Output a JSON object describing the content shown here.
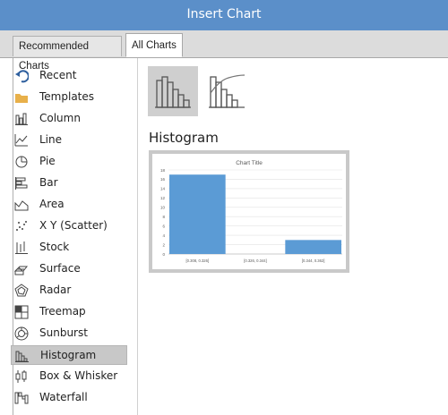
{
  "window": {
    "title": "Insert Chart"
  },
  "tabs": [
    {
      "label": "Recommended Charts",
      "active": false
    },
    {
      "label": "All Charts",
      "active": true
    }
  ],
  "sidebar": {
    "items": [
      {
        "label": "Recent",
        "icon": "undo-arrow-icon"
      },
      {
        "label": "Templates",
        "icon": "folder-icon"
      },
      {
        "label": "Column",
        "icon": "column-chart-icon"
      },
      {
        "label": "Line",
        "icon": "line-chart-icon"
      },
      {
        "label": "Pie",
        "icon": "pie-chart-icon"
      },
      {
        "label": "Bar",
        "icon": "bar-chart-icon"
      },
      {
        "label": "Area",
        "icon": "area-chart-icon"
      },
      {
        "label": "X Y (Scatter)",
        "icon": "scatter-chart-icon"
      },
      {
        "label": "Stock",
        "icon": "stock-chart-icon"
      },
      {
        "label": "Surface",
        "icon": "surface-chart-icon"
      },
      {
        "label": "Radar",
        "icon": "radar-chart-icon"
      },
      {
        "label": "Treemap",
        "icon": "treemap-chart-icon"
      },
      {
        "label": "Sunburst",
        "icon": "sunburst-chart-icon"
      },
      {
        "label": "Histogram",
        "icon": "histogram-chart-icon",
        "selected": true
      },
      {
        "label": "Box & Whisker",
        "icon": "box-whisker-chart-icon"
      },
      {
        "label": "Waterfall",
        "icon": "waterfall-chart-icon"
      }
    ]
  },
  "main": {
    "heading": "Histogram",
    "variants": [
      {
        "name": "histogram",
        "selected": true
      },
      {
        "name": "pareto",
        "selected": false
      }
    ]
  },
  "colors": {
    "titlebar": "#5b8fc9",
    "bar": "#5b9bd5",
    "folder": "#e8b04a",
    "selected_item": "#c8c8c8"
  },
  "chart_data": {
    "type": "bar",
    "title": "Chart Title",
    "categories": [
      "[0.308, 0.326]",
      "[0.326, 0.344]",
      "[0.344, 0.362]"
    ],
    "values": [
      17,
      0,
      3
    ],
    "ylim": [
      0,
      18
    ],
    "yticks": [
      0,
      2,
      4,
      6,
      8,
      10,
      12,
      14,
      16,
      18
    ],
    "grid": true
  }
}
